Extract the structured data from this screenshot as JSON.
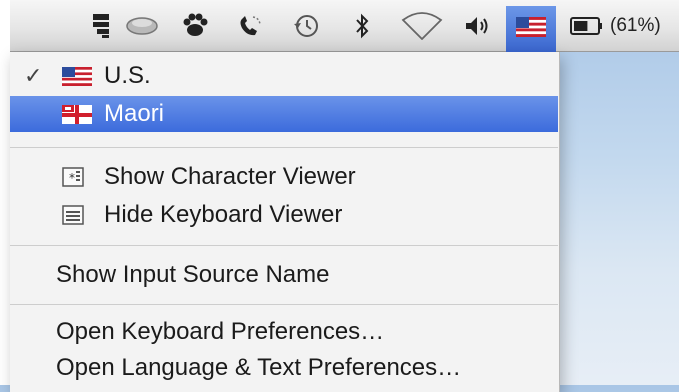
{
  "menubar": {
    "icons": [
      "stacks-icon",
      "cloud-icon",
      "growl-paw-icon",
      "phone-icon",
      "time-machine-icon",
      "bluetooth-icon",
      "wifi-icon",
      "volume-icon",
      "us-flag-icon"
    ],
    "battery": {
      "text": "(61%)",
      "level": 0.61
    }
  },
  "menu": {
    "sources": [
      {
        "label": "U.S.",
        "checked": true,
        "flag": "us-flag-icon"
      },
      {
        "label": "Maori",
        "checked": false,
        "selected": true,
        "flag": "nz-maori-flag-icon"
      }
    ],
    "viewers": [
      {
        "label": "Show Character Viewer",
        "icon": "character-viewer-icon"
      },
      {
        "label": "Hide Keyboard Viewer",
        "icon": "keyboard-viewer-icon"
      }
    ],
    "show_input_source_name": "Show Input Source Name",
    "open_keyboard_prefs": "Open Keyboard Preferences…",
    "open_language_prefs": "Open Language & Text Preferences…"
  },
  "colors": {
    "selection": "#3c6bdc",
    "menu_bg": "#f3f3f3"
  }
}
